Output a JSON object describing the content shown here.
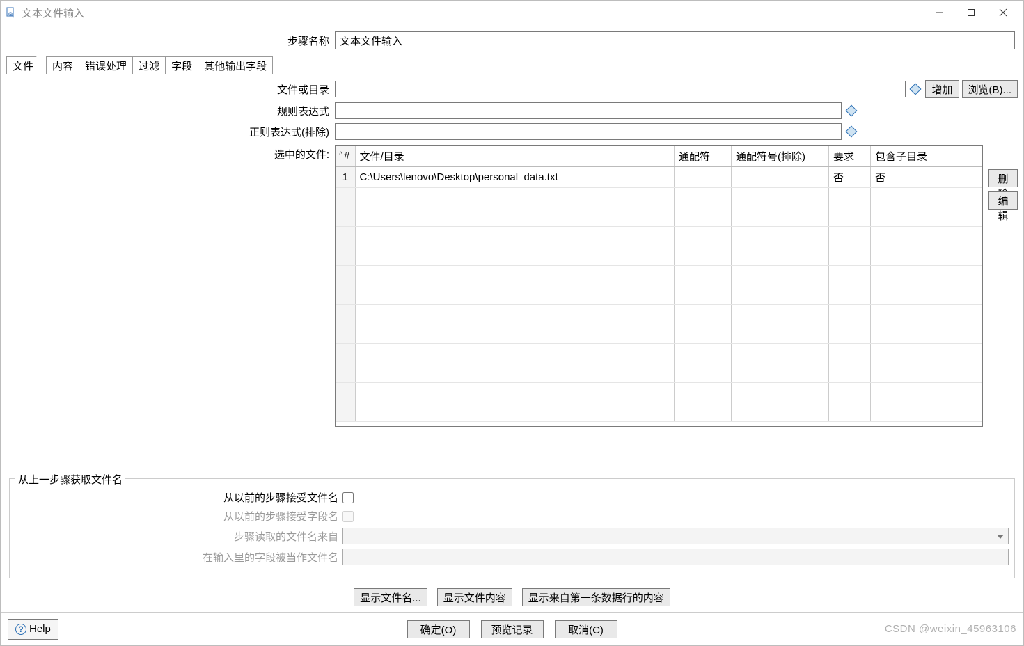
{
  "window": {
    "title": "文本文件输入"
  },
  "step": {
    "label": "步骤名称",
    "value": "文本文件输入"
  },
  "tabs": [
    "文件",
    "内容",
    "错误处理",
    "过滤",
    "字段",
    "其他输出字段"
  ],
  "fileform": {
    "file_or_dir_label": "文件或目录",
    "regex_label": "规则表达式",
    "regex_exclude_label": "正则表达式(排除)",
    "selected_files_label": "选中的文件:",
    "add_btn": "增加",
    "browse_btn": "浏览(B)...",
    "delete_btn": "删除",
    "edit_btn": "编辑"
  },
  "table": {
    "headers": {
      "num": "#",
      "file": "文件/目录",
      "wildcard": "通配符",
      "wildcard_ex": "通配符号(排除)",
      "required": "要求",
      "subdirs": "包含子目录"
    },
    "rows": [
      {
        "num": "1",
        "file": "C:\\Users\\lenovo\\Desktop\\personal_data.txt",
        "wildcard": "",
        "wildcard_ex": "",
        "required": "否",
        "subdirs": "否"
      }
    ]
  },
  "prevstep": {
    "legend": "从上一步骤获取文件名",
    "accept_filename_label": "从以前的步骤接受文件名",
    "accept_field_label": "从以前的步骤接受字段名",
    "step_source_label": "步骤读取的文件名来自",
    "field_as_filename_label": "在输入里的字段被当作文件名"
  },
  "midbuttons": {
    "show_names": "显示文件名...",
    "show_content": "显示文件内容",
    "show_first_row": "显示来自第一条数据行的内容"
  },
  "footer": {
    "help": "Help",
    "ok": "确定(O)",
    "preview": "预览记录",
    "cancel": "取消(C)",
    "watermark": "CSDN @weixin_45963106"
  }
}
